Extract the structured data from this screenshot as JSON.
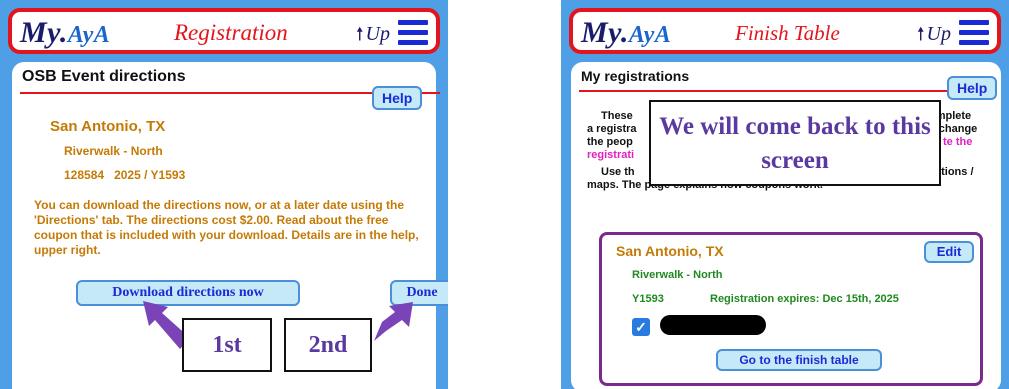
{
  "left_screen": {
    "header": {
      "logo_my": "My",
      "logo_ava": "AyA",
      "title": "Registration",
      "up_arrow": "🠕",
      "up_label": "Up"
    },
    "section_title": "OSB Event directions",
    "help_label": "Help",
    "event": {
      "city": "San Antonio, TX",
      "location": "Riverwalk - North",
      "event_id": "128584",
      "event_code": "2025 / Y1593"
    },
    "description": "You can download the directions now, or at a later date using the 'Directions' tab. The directions cost $2.00. Read about the free coupon that is included with your download. Details are in the help, upper right.",
    "download_button": "Download directions now",
    "done_button": "Done",
    "callout_1": "1st",
    "callout_2": "2nd"
  },
  "right_screen": {
    "header": {
      "logo_my": "My",
      "logo_ava": "AyA",
      "title": "Finish Table",
      "up_arrow": "🠕",
      "up_label": "Up"
    },
    "section_title": "My registrations",
    "help_label": "Help",
    "obscured_text": {
      "line1a": "These",
      "line1b": "omplete",
      "line2a": "a registra",
      "line2b": "o change",
      "line3a": "the peop",
      "line3b": "te the",
      "line4a": "registrati",
      "line5a": "Use th",
      "line5b": "ctions /",
      "line6": "maps. The page explains how coupons work."
    },
    "callout_overlay": "We will come back to this screen",
    "registration": {
      "city": "San Antonio, TX",
      "edit_label": "Edit",
      "location": "Riverwalk - North",
      "code": "Y1593",
      "expires": "Registration expires: Dec 15th, 2025",
      "checkbox_mark": "✓",
      "finish_button": "Go to the finish table"
    }
  },
  "colors": {
    "panel_bg": "#4f9fe7",
    "header_border": "#e3141c",
    "navy": "#1a1b6b",
    "button_bg": "#c6e9f7",
    "button_text": "#1a2bd6",
    "orange_text": "#c57a05",
    "green_text": "#1f8a1f",
    "purple_arrow": "#7a44b8",
    "callout_text": "#5a3aa0",
    "reg_border": "#7a2a8a"
  }
}
